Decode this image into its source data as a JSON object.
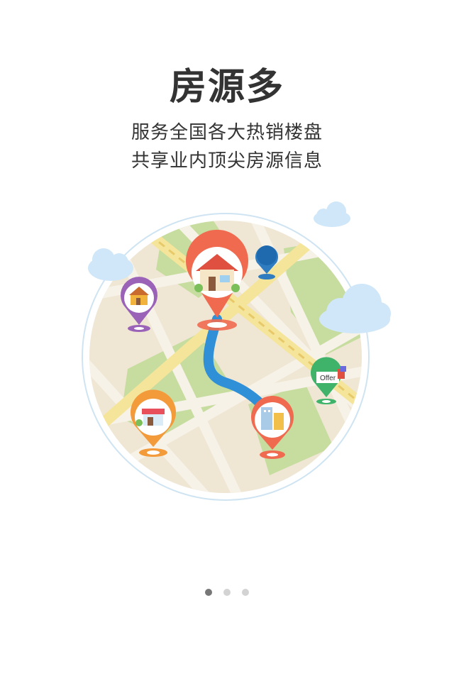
{
  "intro": {
    "title": "房源多",
    "subtitle_line1": "服务全国各大热销楼盘",
    "subtitle_line2": "共享业内顶尖房源信息"
  },
  "illustration": {
    "offer_tag": "Offer",
    "colors": {
      "map_bg": "#EFE6D4",
      "park": "#C7DDA0",
      "road": "#F7F2E8",
      "highway": "#F5E59A",
      "route": "#2F8FD7",
      "cloud": "#CFE7F8",
      "pin_red": "#F06A50",
      "pin_purple": "#9B63B8",
      "pin_orange": "#F39A3A",
      "pin_green": "#3FB36A",
      "pin_blue": "#2F7CC0"
    }
  },
  "pager": {
    "count": 3,
    "active_index": 0
  }
}
